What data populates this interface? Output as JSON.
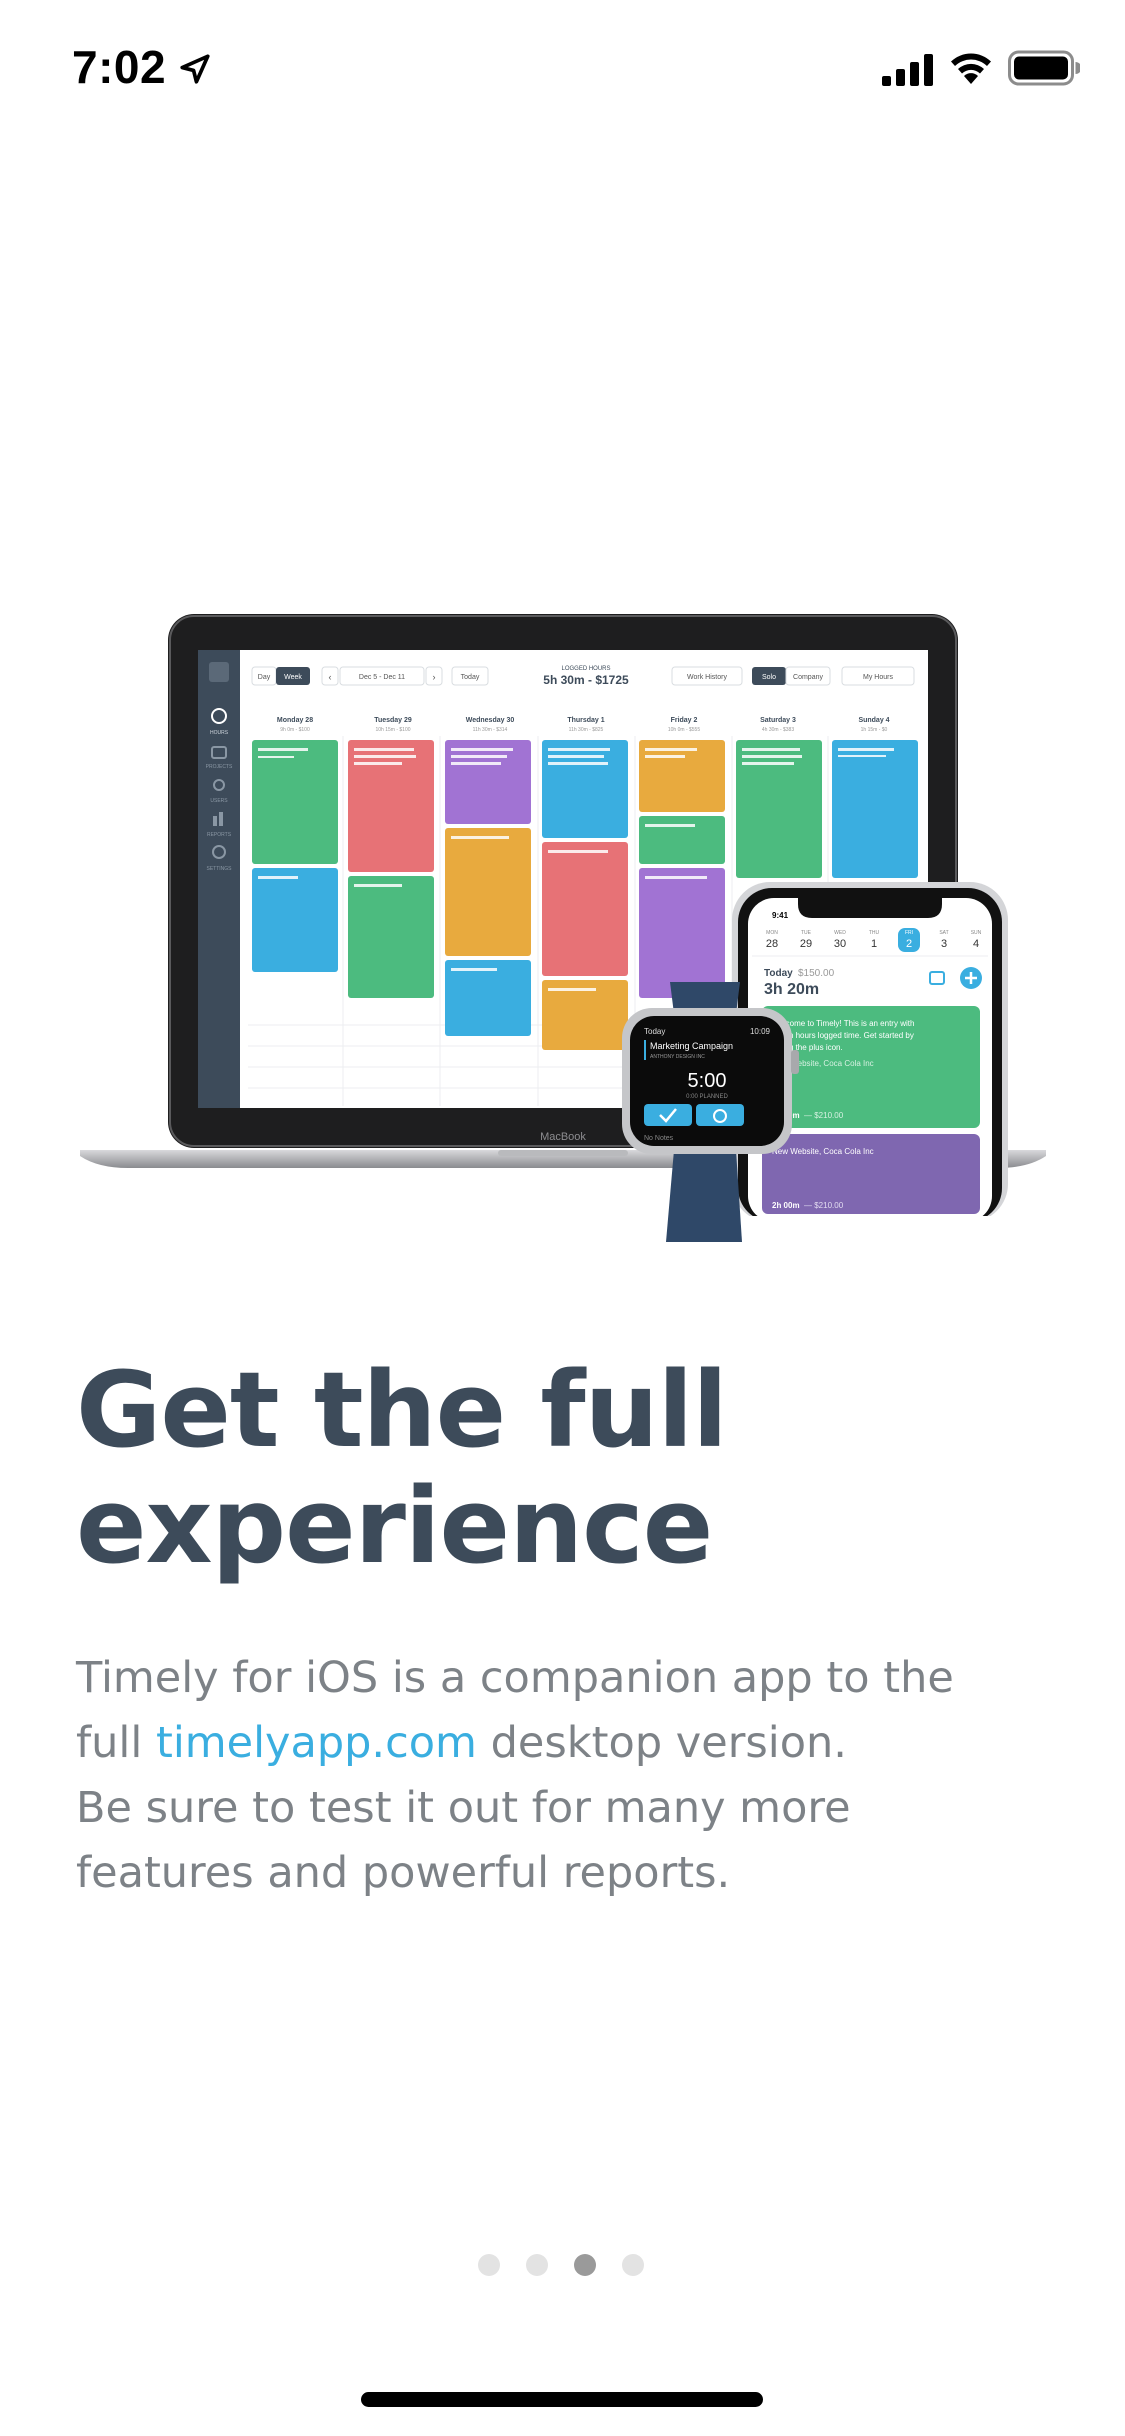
{
  "status_bar": {
    "time": "7:02",
    "icons": [
      "location-arrow-icon",
      "cellular-signal-icon",
      "wifi-icon",
      "battery-icon"
    ]
  },
  "illustration": {
    "laptop": {
      "brand": "MacBook",
      "toolbar": {
        "day_label": "Day",
        "week_label": "Week",
        "date_range": "Dec 5 - Dec 11",
        "today_label": "Today",
        "logged_hours_label": "LOGGED HOURS",
        "logged_total": "5h 30m - $1725",
        "work_history_label": "Work History",
        "solo_label": "Solo",
        "company_label": "Company",
        "my_hours_label": "My Hours"
      },
      "sidebar": [
        "HOURS",
        "PROJECTS",
        "USERS",
        "REPORTS",
        "SETTINGS"
      ],
      "days": [
        {
          "name": "Monday 28",
          "sub": "9h 0m - $100"
        },
        {
          "name": "Tuesday 29",
          "sub": "10h 15m - $100"
        },
        {
          "name": "Wednesday 30",
          "sub": "11h 30m - $314"
        },
        {
          "name": "Thursday 1",
          "sub": "11h 30m - $825"
        },
        {
          "name": "Friday 2",
          "sub": "10h 0m - $555"
        },
        {
          "name": "Saturday 3",
          "sub": "4h 30m - $383"
        },
        {
          "name": "Sunday 4",
          "sub": "1h 15m - $0"
        }
      ]
    },
    "watch": {
      "back_label": "Today",
      "time": "10:09",
      "entry_title": "Marketing Campaign",
      "entry_client": "ANTHONY DESIGN INC",
      "timer": "5:00",
      "planned": "0:00 PLANNED",
      "notes": "No Notes"
    },
    "phone": {
      "time": "9:41",
      "week_days": [
        {
          "dow": "MON",
          "num": "28"
        },
        {
          "dow": "TUE",
          "num": "29"
        },
        {
          "dow": "WED",
          "num": "30"
        },
        {
          "dow": "THU",
          "num": "1"
        },
        {
          "dow": "FRI",
          "num": "2"
        },
        {
          "dow": "SAT",
          "num": "3"
        },
        {
          "dow": "SUN",
          "num": "4"
        }
      ],
      "today_label": "Today",
      "today_amount": "$150.00",
      "today_hours": "3h 20m",
      "entries": [
        {
          "text": "Welcome to Timely! This is an entry with seven hours logged time. Get started by hitting the plus icon.",
          "project": "New Website, Coca Cola Inc",
          "duration": "7h 00m",
          "amount": "— $210.00"
        },
        {
          "text": "New Website, Coca Cola Inc",
          "project": "",
          "duration": "2h 00m",
          "amount": "— $210.00"
        }
      ]
    }
  },
  "headline": {
    "line1": "Get the full",
    "line2": "experience"
  },
  "body": {
    "line1": "Timely for iOS is a companion app to the",
    "line2_prefix": "full ",
    "line2_link": "timelyapp.com",
    "line2_suffix": " desktop version.",
    "line3": "Be sure to test it out for many more",
    "line4": "features and powerful reports."
  },
  "pager": {
    "total": 4,
    "current": 3
  },
  "colors": {
    "headline": "#3d4b5a",
    "body": "#7d8287",
    "link": "#3aaee0",
    "green": "#4cbb7f",
    "purple": "#7f67b0",
    "blue": "#3aaee0"
  }
}
